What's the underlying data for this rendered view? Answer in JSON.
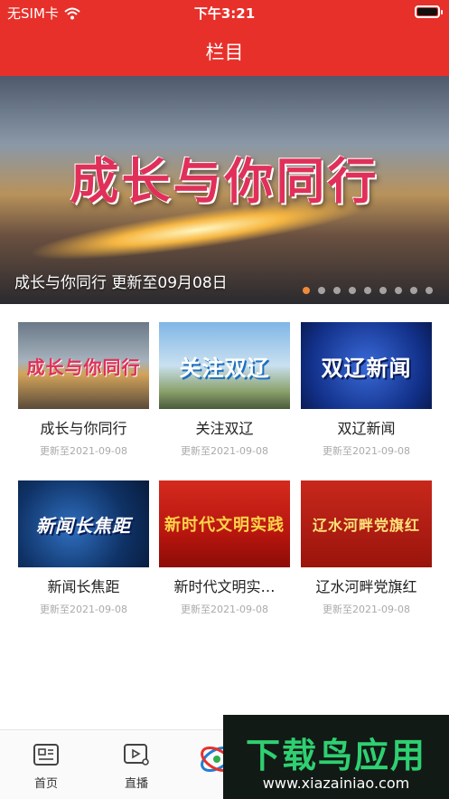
{
  "status": {
    "carrier": "无SIM卡",
    "time": "下午3:21"
  },
  "header": {
    "title": "栏目"
  },
  "banner": {
    "art_text": "成长与你同行",
    "caption": "成长与你同行 更新至09月08日",
    "dot_count": 9,
    "active_dot": 0
  },
  "programs": [
    {
      "name": "成长与你同行",
      "date": "更新至2021-09-08",
      "thumb_text": "成长与你同行"
    },
    {
      "name": "关注双辽",
      "date": "更新至2021-09-08",
      "thumb_text": "关注双辽"
    },
    {
      "name": "双辽新闻",
      "date": "更新至2021-09-08",
      "thumb_text": "双辽新闻"
    },
    {
      "name": "新闻长焦距",
      "date": "更新至2021-09-08",
      "thumb_text": "新闻长焦距"
    },
    {
      "name": "新时代文明实…",
      "date": "更新至2021-09-08",
      "thumb_text": "新时代文明实践"
    },
    {
      "name": "辽水河畔党旗红",
      "date": "更新至2021-09-08",
      "thumb_text": "辽水河畔党旗红"
    }
  ],
  "tabbar": {
    "home_label": "首页",
    "live_label": "直播"
  },
  "watermark": {
    "title": "下载鸟应用",
    "url": "www.xiazainiao.com"
  },
  "colors": {
    "brand_red": "#e8302a",
    "active_dot": "#f08a3a",
    "watermark_green": "#2fd071"
  }
}
